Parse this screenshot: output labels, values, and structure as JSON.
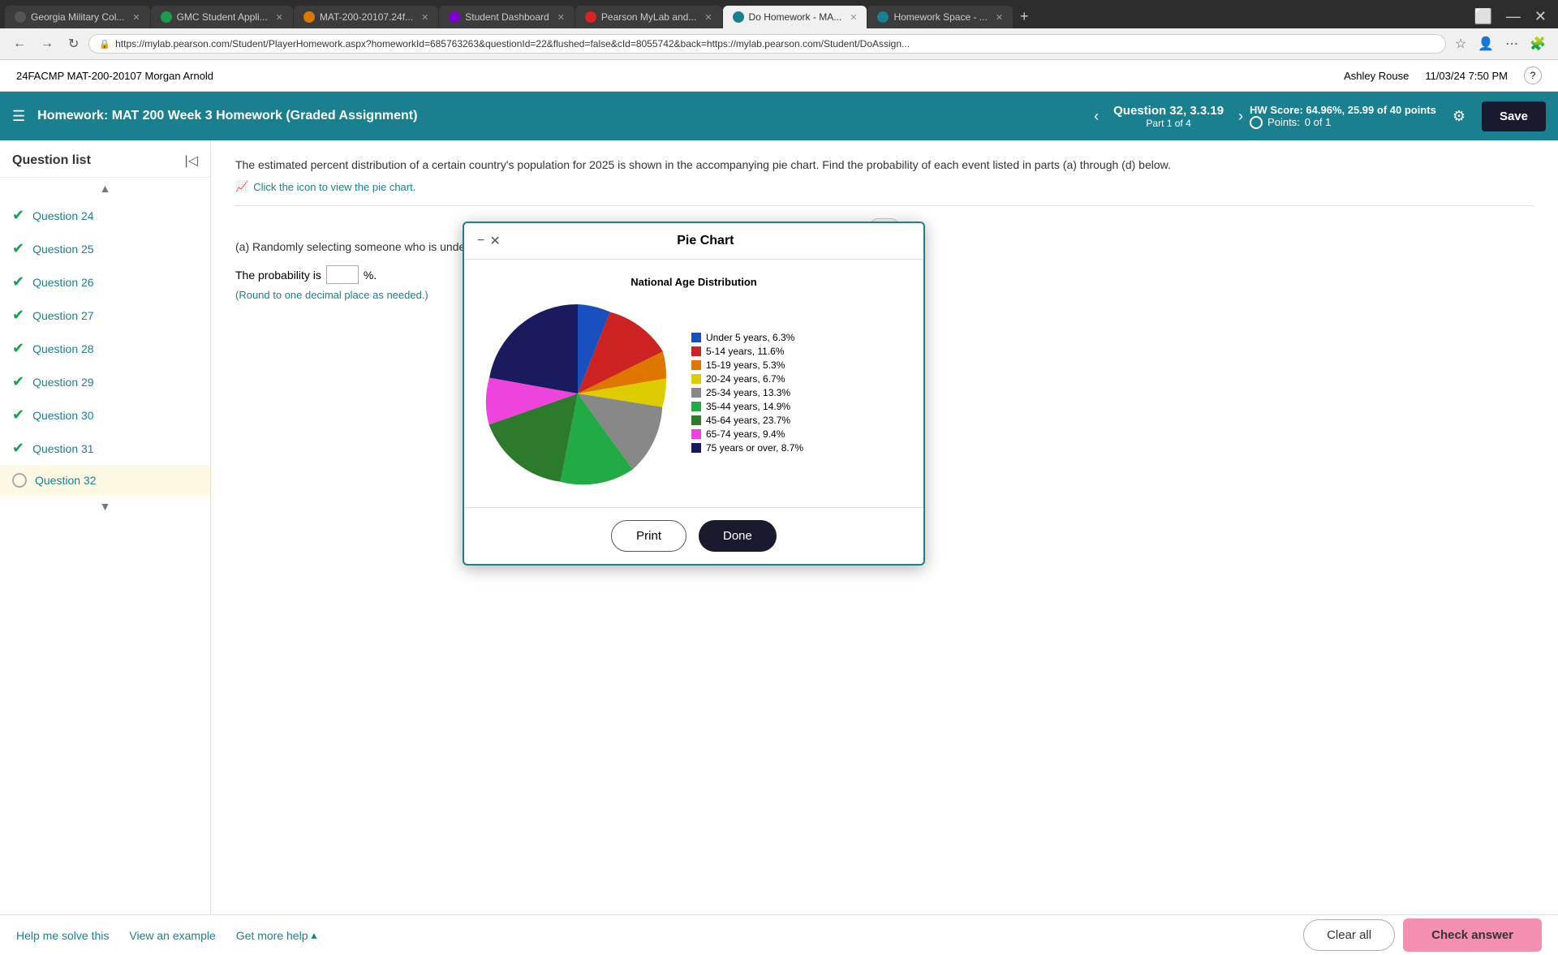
{
  "browser": {
    "url": "https://mylab.pearson.com/Student/PlayerHomework.aspx?homeworkId=685763263&questionId=22&flushed=false&cId=8055742&back=https://mylab.pearson.com/Student/DoAssign...",
    "tabs": [
      {
        "id": "tab1",
        "label": "Georgia Military Col...",
        "favicon": "georgia",
        "active": false
      },
      {
        "id": "tab2",
        "label": "GMC Student Appli...",
        "favicon": "gmc",
        "active": false
      },
      {
        "id": "tab3",
        "label": "MAT-200-20107.24f...",
        "favicon": "mat",
        "active": false
      },
      {
        "id": "tab4",
        "label": "Student Dashboard",
        "favicon": "student",
        "active": false
      },
      {
        "id": "tab5",
        "label": "Pearson MyLab and...",
        "favicon": "pearson",
        "active": false
      },
      {
        "id": "tab6",
        "label": "Do Homework - MA...",
        "favicon": "homework",
        "active": true
      },
      {
        "id": "tab7",
        "label": "Homework Space - ...",
        "favicon": "space",
        "active": false
      }
    ]
  },
  "app_header": {
    "course_info": "24FACMP MAT-200-20107 Morgan Arnold",
    "user": "Ashley Rouse",
    "datetime": "11/03/24 7:50 PM",
    "help_label": "?"
  },
  "nav": {
    "homework_label": "Homework:",
    "homework_title": "MAT 200 Week 3 Homework (Graded Assignment)",
    "question_label": "Question 32, 3.3.19",
    "question_part": "Part 1 of 4",
    "hw_score_label": "HW Score:",
    "hw_score_value": "64.96%, 25.99 of 40 points",
    "points_label": "Points:",
    "points_value": "0 of 1",
    "save_label": "Save"
  },
  "sidebar": {
    "title": "Question list",
    "items": [
      {
        "id": "q24",
        "label": "Question 24",
        "status": "check"
      },
      {
        "id": "q25",
        "label": "Question 25",
        "status": "check"
      },
      {
        "id": "q26",
        "label": "Question 26",
        "status": "check"
      },
      {
        "id": "q27",
        "label": "Question 27",
        "status": "check"
      },
      {
        "id": "q28",
        "label": "Question 28",
        "status": "check"
      },
      {
        "id": "q29",
        "label": "Question 29",
        "status": "check"
      },
      {
        "id": "q30",
        "label": "Question 30",
        "status": "check"
      },
      {
        "id": "q31",
        "label": "Question 31",
        "status": "check"
      },
      {
        "id": "q32",
        "label": "Question 32",
        "status": "circle",
        "active": true
      }
    ]
  },
  "question": {
    "main_text": "The estimated percent distribution of a certain country's population for 2025 is shown in the accompanying pie chart. Find the probability of each event listed in parts (a) through (d) below.",
    "chart_link": "Click the icon to view the pie chart.",
    "sub_a": "(a) Randomly selecting someone who is under 5 years old",
    "probability_label": "The probability is",
    "probability_value": "",
    "percent_symbol": "%.",
    "round_note": "(Round to one decimal place as needed.)",
    "expand_label": "..."
  },
  "pie_chart": {
    "title": "Pie Chart",
    "chart_title": "National Age Distribution",
    "segments": [
      {
        "label": "Under 5 years, 6.3%",
        "color": "#1a4fbf",
        "value": 6.3,
        "start": 0
      },
      {
        "label": "5-14 years, 11.6%",
        "color": "#cc2222",
        "value": 11.6
      },
      {
        "label": "15-19 years, 5.3%",
        "color": "#dd7700",
        "value": 5.3
      },
      {
        "label": "20-24 years, 6.7%",
        "color": "#ddcc00",
        "value": 6.7
      },
      {
        "label": "25-34 years, 13.3%",
        "color": "#888888",
        "value": 13.3
      },
      {
        "label": "35-44 years, 14.9%",
        "color": "#22aa44",
        "value": 14.9
      },
      {
        "label": "45-64 years, 23.7%",
        "color": "#2d7a2d",
        "value": 23.7
      },
      {
        "label": "65-74 years, 9.4%",
        "color": "#ee44dd",
        "value": 9.4
      },
      {
        "label": "75 years or over, 8.7%",
        "color": "#1a1a5e",
        "value": 8.7
      }
    ],
    "print_label": "Print",
    "done_label": "Done"
  },
  "bottom_toolbar": {
    "help_me_solve": "Help me solve this",
    "view_example": "View an example",
    "get_more_help": "Get more help",
    "clear_all": "Clear all",
    "check_answer": "Check answer"
  }
}
